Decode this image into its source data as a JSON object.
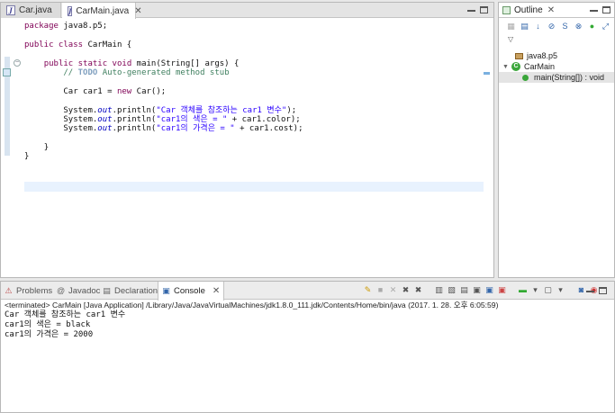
{
  "editor": {
    "tabs": [
      {
        "label": "Car.java",
        "active": false
      },
      {
        "label": "CarMain.java",
        "active": true
      }
    ],
    "close_glyph": "✕",
    "code": {
      "l1_kw": "package",
      "l1_rest": " java8.p5;",
      "l3_kw1": "public",
      "l3_kw2": " class",
      "l3_rest": " CarMain {",
      "l5_kw1": "public",
      "l5_kw2": " static",
      "l5_kw3": " void",
      "l5_rest": " main(String[] args) {",
      "l6_cmt_a": "// ",
      "l6_todo": "TODO",
      "l6_cmt_b": " Auto-generated method stub",
      "l8_a": "Car car1 = ",
      "l8_kw": "new",
      "l8_b": " Car();",
      "l10_a": "System.",
      "l10_fld": "out",
      "l10_b": ".println(",
      "l10_str": "\"Car 객체를 참조하는 car1 변수\"",
      "l10_c": ");",
      "l11_a": "System.",
      "l11_fld": "out",
      "l11_b": ".println(",
      "l11_str": "\"car1의 색은 = \"",
      "l11_c": " + car1.color);",
      "l12_a": "System.",
      "l12_fld": "out",
      "l12_b": ".println(",
      "l12_str": "\"car1의 가격은 = \"",
      "l12_c": " + car1.cost);",
      "l14": "}",
      "l15": "}"
    }
  },
  "outline": {
    "title": "Outline",
    "close_glyph": "✕",
    "package": "java8.p5",
    "class_name": "CarMain",
    "method": "main(String[]) : void"
  },
  "bottom": {
    "tabs": [
      {
        "label": "Problems"
      },
      {
        "label": "Javadoc"
      },
      {
        "label": "Declaration"
      },
      {
        "label": "Console"
      }
    ],
    "close_glyph": "✕",
    "terminated": "<terminated> CarMain [Java Application] /Library/Java/JavaVirtualMachines/jdk1.8.0_111.jdk/Contents/Home/bin/java (2017. 1. 28. 오후 6:05:59)",
    "output": [
      "Car 객체를 참조하는 car1 변수",
      "car1의 색은 = black",
      "car1의 가격은 = 2000"
    ]
  },
  "colors": {
    "keyword": "#7f0055",
    "string": "#2a00ff",
    "comment": "#3f7f5f",
    "current_line": "#e8f2fe"
  }
}
